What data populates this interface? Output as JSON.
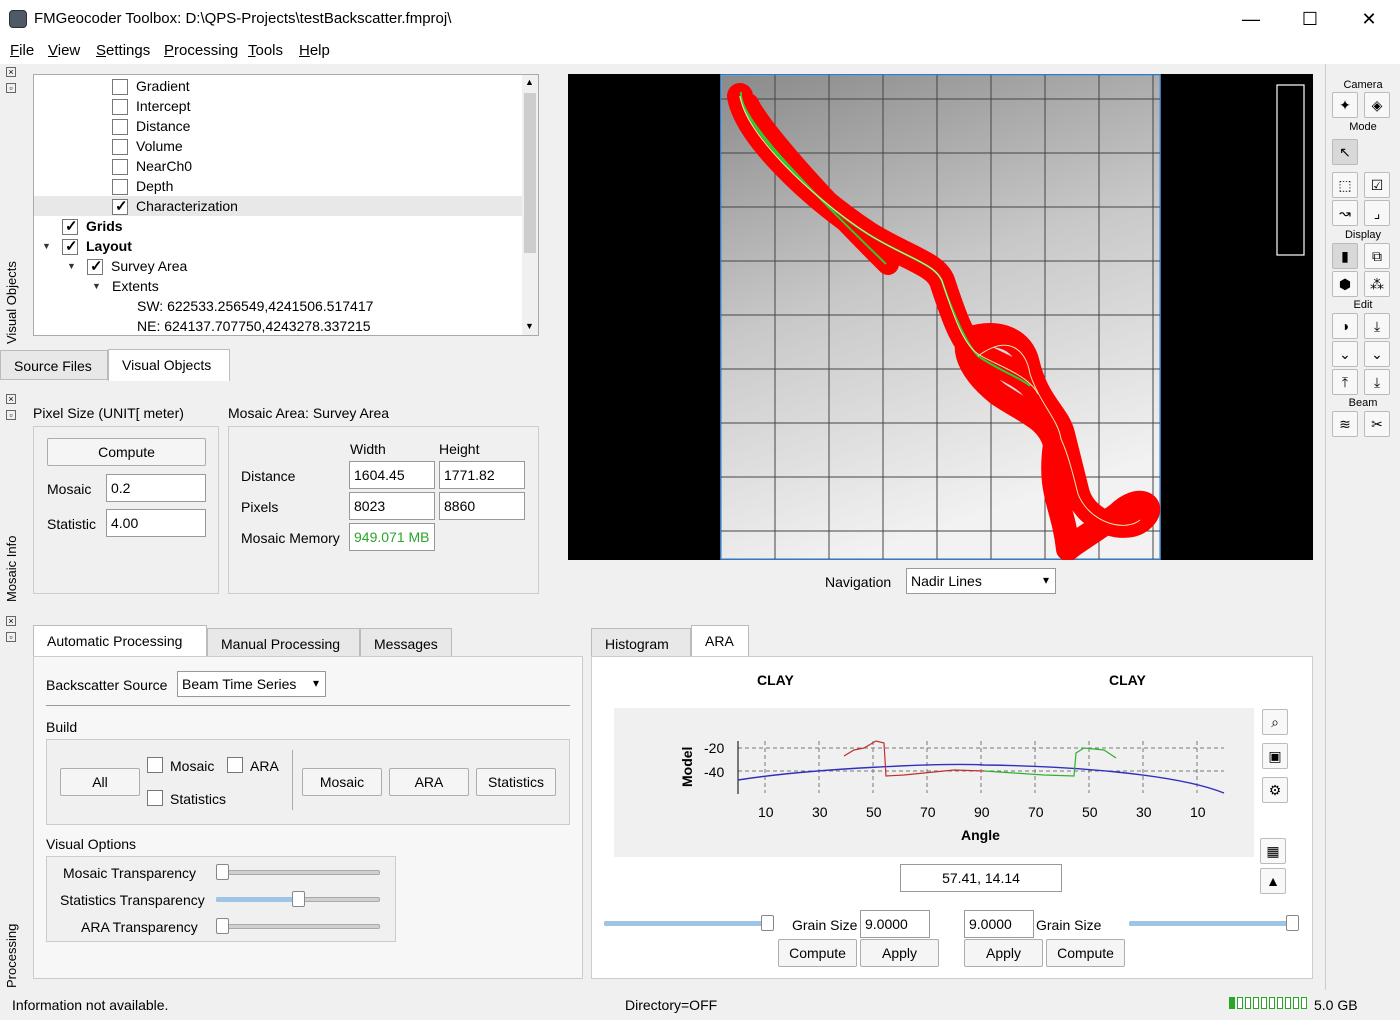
{
  "window": {
    "title": "FMGeocoder Toolbox: D:\\QPS-Projects\\testBackscatter.fmproj\\",
    "minimize": "—",
    "maximize": "☐",
    "close": "✕"
  },
  "menu": [
    "File",
    "View",
    "Settings",
    "Processing",
    "Tools",
    "Help"
  ],
  "side_labels": {
    "visual_objects": "Visual Objects",
    "mosaic_info": "Mosaic Info",
    "processing": "Processing"
  },
  "tree": {
    "rows": [
      {
        "label": "Gradient",
        "checked": false
      },
      {
        "label": "Intercept",
        "checked": false
      },
      {
        "label": "Distance",
        "checked": false
      },
      {
        "label": "Volume",
        "checked": false
      },
      {
        "label": "NearCh0",
        "checked": false
      },
      {
        "label": "Depth",
        "checked": false
      },
      {
        "label": "Characterization",
        "checked": true
      }
    ],
    "grids": "Grids",
    "layout": "Layout",
    "survey_area": "Survey Area",
    "extents": "Extents",
    "sw": "SW: 622533.256549,4241506.517417",
    "ne": "NE: 624137.707750,4243278.337215"
  },
  "tabs_top": [
    "Source Files",
    "Visual Objects"
  ],
  "mosaic": {
    "pixel_size_label": "Pixel Size (UNIT[ meter)",
    "compute": "Compute",
    "mosaic_label": "Mosaic",
    "mosaic_val": "0.2",
    "statistic_label": "Statistic",
    "statistic_val": "4.00",
    "area_label": "Mosaic Area:  Survey Area",
    "width": "Width",
    "height": "Height",
    "distance_label": "Distance",
    "distance_w": "1604.45",
    "distance_h": "1771.82",
    "pixels_label": "Pixels",
    "pixels_w": "8023",
    "pixels_h": "8860",
    "memory_label": "Mosaic Memory",
    "memory_val": "949.071 MB",
    "memory_color": "#2aa52a"
  },
  "navigation": {
    "label": "Navigation",
    "value": "Nadir Lines"
  },
  "proc_tabs": [
    "Automatic Processing",
    "Manual Processing",
    "Messages"
  ],
  "proc": {
    "bs_source_label": "Backscatter Source",
    "bs_source": "Beam Time Series",
    "build": "Build",
    "all": "All",
    "chk_mosaic": "Mosaic",
    "chk_ara": "ARA",
    "chk_statistics": "Statistics",
    "btn_mosaic": "Mosaic",
    "btn_ara": "ARA",
    "btn_statistics": "Statistics",
    "visual_options": "Visual Options",
    "sliders": [
      {
        "label": "Mosaic Transparency",
        "value": 0
      },
      {
        "label": "Statistics Transparency",
        "value": 0.5
      },
      {
        "label": "ARA Transparency",
        "value": 0
      }
    ]
  },
  "ara_tabs": [
    "Histogram",
    "ARA"
  ],
  "ara": {
    "left_class": "CLAY",
    "right_class": "CLAY",
    "ylabel": "Model",
    "xlabel": "Angle",
    "yticks": [
      "-20",
      "-40"
    ],
    "xticks": [
      "10",
      "30",
      "50",
      "70",
      "90",
      "70",
      "50",
      "30",
      "10"
    ],
    "readout": "57.41, 14.14",
    "grain_label": "Grain Size",
    "grain_left": "9.0000",
    "grain_right": "9.0000",
    "compute": "Compute",
    "apply": "Apply",
    "left_slider": 1,
    "right_slider": 1
  },
  "toolbar": {
    "camera": "Camera",
    "mode": "Mode",
    "display": "Display",
    "edit": "Edit",
    "beam": "Beam"
  },
  "status": {
    "info": "Information not available.",
    "directory": "Directory=OFF",
    "memory": "5.0 GB",
    "memory_fraction": 0.1
  },
  "colors": {
    "track": "#ff0000",
    "nav": "#2ecc2e",
    "accent": "#0078d7"
  }
}
